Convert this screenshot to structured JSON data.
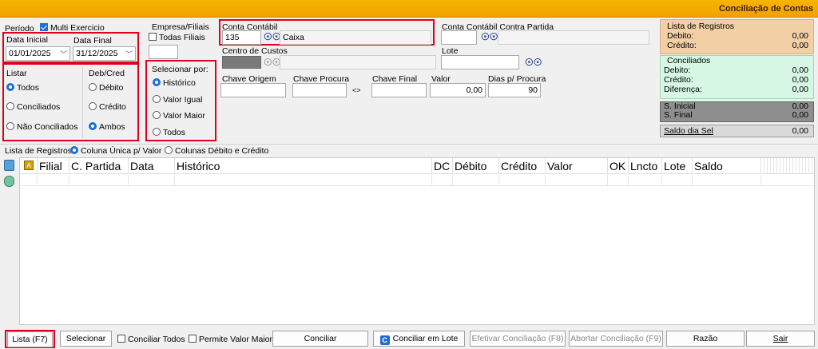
{
  "window": {
    "title": "Conciliação de Contas"
  },
  "periodo": {
    "label": "Período",
    "multi_exercicio_label": "Multi Exercicio",
    "data_inicial_label": "Data Inicial",
    "data_inicial_value": "01/01/2025",
    "data_final_label": "Data Final",
    "data_final_value": "31/12/2025"
  },
  "listar": {
    "label": "Listar",
    "options": [
      "Todos",
      "Conciliados",
      "Não Conciliados"
    ],
    "selected": "Todos"
  },
  "deb_cred": {
    "label": "Deb/Cred",
    "options": [
      "Débito",
      "Crédito",
      "Ambos"
    ],
    "selected": "Ambos"
  },
  "empresa": {
    "label": "Empresa/Filiais",
    "todas_filiais_label": "Todas Filiais",
    "value": ""
  },
  "selecionar_por": {
    "label": "Selecionar por:",
    "options": [
      "Histórico",
      "Valor Igual",
      "Valor Maior",
      "Todos"
    ],
    "selected": "Histórico"
  },
  "conta_contabil": {
    "label": "Conta Contábil",
    "code": "135",
    "name": "Caixa"
  },
  "contra_partida": {
    "label": "Conta Contábil Contra Partida",
    "code": "",
    "name": ""
  },
  "centro_custos": {
    "label": "Centro de Custos",
    "code": "",
    "name": ""
  },
  "lote": {
    "label": "Lote",
    "value": ""
  },
  "chaves": {
    "chave_origem_label": "Chave Origem",
    "chave_procura_label": "Chave Procura",
    "swap_symbol": "<>",
    "chave_final_label": "Chave Final",
    "valor_label": "Valor",
    "valor_value": "0,00",
    "dias_label": "Dias p/ Procura",
    "dias_value": "90"
  },
  "summary": {
    "lista_title": "Lista de Registros",
    "debito_label": "Debito:",
    "debito_value": "0,00",
    "credito_label": "Crédito:",
    "credito_value": "0,00",
    "conciliados_title": "Conciliados",
    "conc_debito_label": "Debito:",
    "conc_debito_value": "0,00",
    "conc_credito_label": "Crédito:",
    "conc_credito_value": "0,00",
    "diferenca_label": "Diferença:",
    "diferenca_value": "0,00",
    "s_inicial_label": "S. Inicial",
    "s_inicial_value": "0,00",
    "s_final_label": "S. Final",
    "s_final_value": "0,00",
    "saldo_dia_label": "Saldo dia Sel",
    "saldo_dia_value": "0,00"
  },
  "lista_registros": {
    "label": "Lista de Registros",
    "option_unica": "Coluna Única p/ Valor",
    "option_colunas": "Colunas Débito e Crédito",
    "selected": "Coluna Única p/ Valor"
  },
  "grid": {
    "columns": [
      "Filial",
      "C. Partida",
      "Data",
      "Histórico",
      "DC",
      "Débito",
      "Crédito",
      "Valor",
      "OK",
      "Lncto",
      "Lote",
      "Saldo"
    ]
  },
  "footer": {
    "lista": "Lista (F7)",
    "selecionar": "Selecionar",
    "conciliar_todos": "Conciliar Todos",
    "permite_valor_maior": "Permite Valor Maior",
    "conciliar": "Conciliar",
    "conciliar_lote": "Conciliar  em Lote",
    "efetivar": "Efetivar Conciliação (F8)",
    "abortar": "Abortar Conciliação (F9)",
    "razao": "Razão",
    "sair": "Sair"
  }
}
